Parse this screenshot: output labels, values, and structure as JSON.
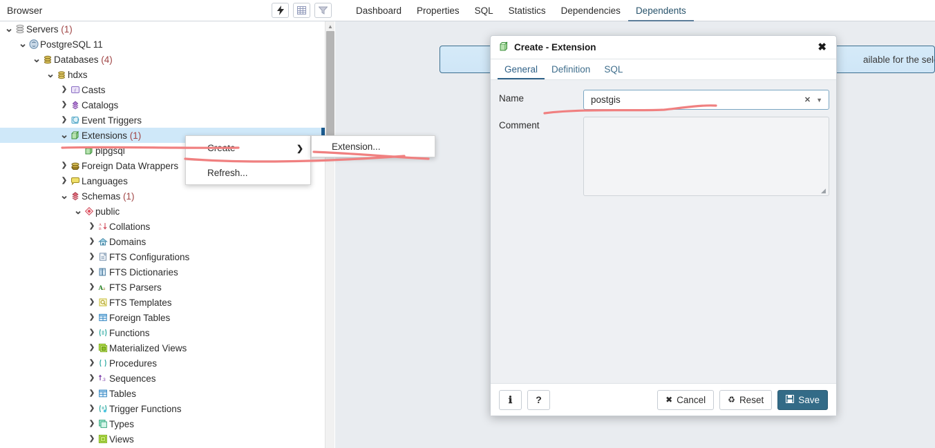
{
  "topbar": {
    "browser_title": "Browser",
    "tool_buttons": [
      {
        "name": "query-tool-icon",
        "label": "Query Tool"
      },
      {
        "name": "view-data-icon",
        "label": "View Data"
      },
      {
        "name": "filter-icon",
        "label": "Filtered Rows"
      }
    ],
    "nav_tabs": [
      {
        "label": "Dashboard",
        "active": false
      },
      {
        "label": "Properties",
        "active": false
      },
      {
        "label": "SQL",
        "active": false
      },
      {
        "label": "Statistics",
        "active": false
      },
      {
        "label": "Dependencies",
        "active": false
      },
      {
        "label": "Dependents",
        "active": true
      }
    ]
  },
  "tree": {
    "items": [
      {
        "label": "Servers (1)",
        "count": "",
        "indent": 0,
        "chevron": "down",
        "icon": "servers-icon",
        "selected": false
      },
      {
        "label": "PostgreSQL 11",
        "count": "",
        "indent": 1,
        "chevron": "down",
        "icon": "postgresql-icon",
        "selected": false
      },
      {
        "label": "Databases (4)",
        "count": "",
        "indent": 2,
        "chevron": "down",
        "icon": "databases-icon",
        "selected": false
      },
      {
        "label": "hdxs",
        "count": "",
        "indent": 3,
        "chevron": "down",
        "icon": "database-icon",
        "selected": false
      },
      {
        "label": "Casts",
        "count": "",
        "indent": 4,
        "chevron": "right",
        "icon": "casts-icon",
        "selected": false
      },
      {
        "label": "Catalogs",
        "count": "",
        "indent": 4,
        "chevron": "right",
        "icon": "catalogs-icon",
        "selected": false
      },
      {
        "label": "Event Triggers",
        "count": "",
        "indent": 4,
        "chevron": "right",
        "icon": "event-triggers-icon",
        "selected": false
      },
      {
        "label": "Extensions (1)",
        "count": "",
        "indent": 4,
        "chevron": "down",
        "icon": "extensions-icon",
        "selected": true
      },
      {
        "label": "plpgsql",
        "count": "",
        "indent": 5,
        "chevron": "none",
        "icon": "extension-icon",
        "selected": false
      },
      {
        "label": "Foreign Data Wrappers",
        "count": "",
        "indent": 4,
        "chevron": "right",
        "icon": "foreign-data-wrappers-icon",
        "selected": false
      },
      {
        "label": "Languages",
        "count": "",
        "indent": 4,
        "chevron": "right",
        "icon": "languages-icon",
        "selected": false
      },
      {
        "label": "Schemas (1)",
        "count": "",
        "indent": 4,
        "chevron": "down",
        "icon": "schemas-icon",
        "selected": false
      },
      {
        "label": "public",
        "count": "",
        "indent": 5,
        "chevron": "down",
        "icon": "schema-icon",
        "selected": false
      },
      {
        "label": "Collations",
        "count": "",
        "indent": 6,
        "chevron": "right",
        "icon": "collations-icon",
        "selected": false
      },
      {
        "label": "Domains",
        "count": "",
        "indent": 6,
        "chevron": "right",
        "icon": "domains-icon",
        "selected": false
      },
      {
        "label": "FTS Configurations",
        "count": "",
        "indent": 6,
        "chevron": "right",
        "icon": "fts-configurations-icon",
        "selected": false
      },
      {
        "label": "FTS Dictionaries",
        "count": "",
        "indent": 6,
        "chevron": "right",
        "icon": "fts-dictionaries-icon",
        "selected": false
      },
      {
        "label": "FTS Parsers",
        "count": "",
        "indent": 6,
        "chevron": "right",
        "icon": "fts-parsers-icon",
        "selected": false
      },
      {
        "label": "FTS Templates",
        "count": "",
        "indent": 6,
        "chevron": "right",
        "icon": "fts-templates-icon",
        "selected": false
      },
      {
        "label": "Foreign Tables",
        "count": "",
        "indent": 6,
        "chevron": "right",
        "icon": "foreign-tables-icon",
        "selected": false
      },
      {
        "label": "Functions",
        "count": "",
        "indent": 6,
        "chevron": "right",
        "icon": "functions-icon",
        "selected": false
      },
      {
        "label": "Materialized Views",
        "count": "",
        "indent": 6,
        "chevron": "right",
        "icon": "materialized-views-icon",
        "selected": false
      },
      {
        "label": "Procedures",
        "count": "",
        "indent": 6,
        "chevron": "right",
        "icon": "procedures-icon",
        "selected": false
      },
      {
        "label": "Sequences",
        "count": "",
        "indent": 6,
        "chevron": "right",
        "icon": "sequences-icon",
        "selected": false
      },
      {
        "label": "Tables",
        "count": "",
        "indent": 6,
        "chevron": "right",
        "icon": "tables-icon",
        "selected": false
      },
      {
        "label": "Trigger Functions",
        "count": "",
        "indent": 6,
        "chevron": "right",
        "icon": "trigger-functions-icon",
        "selected": false
      },
      {
        "label": "Types",
        "count": "",
        "indent": 6,
        "chevron": "right",
        "icon": "types-icon",
        "selected": false
      },
      {
        "label": "Views",
        "count": "",
        "indent": 6,
        "chevron": "right",
        "icon": "views-icon",
        "selected": false
      }
    ]
  },
  "context_menu": {
    "items": [
      {
        "label": "Create",
        "has_submenu": true
      },
      {
        "label": "Refresh...",
        "has_submenu": false
      }
    ],
    "submenu": [
      {
        "label": "Extension..."
      }
    ]
  },
  "main": {
    "info_alert_text": "ailable for the selected o"
  },
  "dialog": {
    "title": "Create - Extension",
    "close_label": "✖",
    "tabs": [
      {
        "label": "General",
        "active": true
      },
      {
        "label": "Definition",
        "active": false
      },
      {
        "label": "SQL",
        "active": false
      }
    ],
    "fields": {
      "name_label": "Name",
      "name_value": "postgis",
      "name_clear": "✕",
      "name_caret": "▼",
      "comment_label": "Comment",
      "comment_value": ""
    },
    "footer": {
      "info_label": "ℹ",
      "help_label": "?",
      "cancel_label": "Cancel",
      "cancel_glyph": "✖",
      "reset_label": "Reset",
      "reset_glyph": "♻",
      "save_label": "Save",
      "save_glyph": "Ὃe"
    }
  },
  "colors": {
    "accent": "#336b87",
    "selection": "#cfe8f9",
    "annotation": "#f08080",
    "tab_active": "#2f6187"
  }
}
